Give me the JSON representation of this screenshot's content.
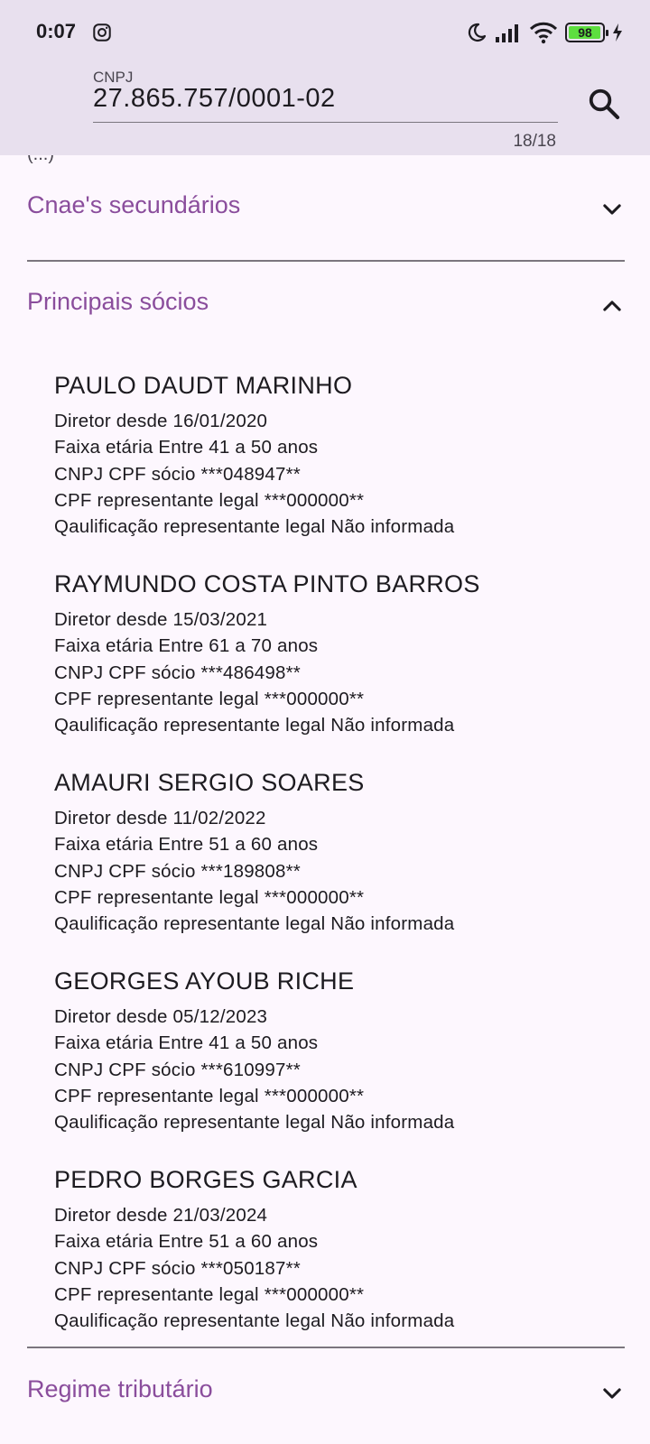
{
  "status_bar": {
    "time": "0:07",
    "battery": "98",
    "icons": [
      "instagram-icon",
      "moon-icon",
      "signal-icon",
      "wifi-icon",
      "battery-icon",
      "charging-icon"
    ]
  },
  "search": {
    "label": "CNPJ",
    "value": "27.865.757/0001-02",
    "counter": "18/18",
    "icon": "search-icon"
  },
  "above_text": "(...)",
  "sections": {
    "cnae_secundarios": {
      "title": "Cnae's secundários",
      "expanded": false
    },
    "principais_socios": {
      "title": "Principais sócios",
      "expanded": true
    },
    "regime_tributario": {
      "title": "Regime tributário",
      "expanded": false
    }
  },
  "partners": [
    {
      "name": "PAULO DAUDT MARINHO",
      "since": "Diretor desde 16/01/2020",
      "age_range": "Faixa etária Entre 41 a 50 anos",
      "cpf": "CNPJ CPF sócio ***048947**",
      "rep_cpf": "CPF representante legal ***000000**",
      "rep_qual": "Qaulificação representante legal Não informada"
    },
    {
      "name": "RAYMUNDO COSTA PINTO BARROS",
      "since": "Diretor desde 15/03/2021",
      "age_range": "Faixa etária Entre 61 a 70 anos",
      "cpf": "CNPJ CPF sócio ***486498**",
      "rep_cpf": "CPF representante legal ***000000**",
      "rep_qual": "Qaulificação representante legal Não informada"
    },
    {
      "name": "AMAURI SERGIO SOARES",
      "since": "Diretor desde 11/02/2022",
      "age_range": "Faixa etária Entre 51 a 60 anos",
      "cpf": "CNPJ CPF sócio ***189808**",
      "rep_cpf": "CPF representante legal ***000000**",
      "rep_qual": "Qaulificação representante legal Não informada"
    },
    {
      "name": "GEORGES AYOUB RICHE",
      "since": "Diretor desde 05/12/2023",
      "age_range": "Faixa etária Entre 41 a 50 anos",
      "cpf": "CNPJ CPF sócio ***610997**",
      "rep_cpf": "CPF representante legal ***000000**",
      "rep_qual": "Qaulificação representante legal Não informada"
    },
    {
      "name": "PEDRO BORGES GARCIA",
      "since": "Diretor desde 21/03/2024",
      "age_range": "Faixa etária Entre 51 a 60 anos",
      "cpf": "CNPJ CPF sócio ***050187**",
      "rep_cpf": "CPF representante legal ***000000**",
      "rep_qual": "Qaulificação representante legal Não informada"
    }
  ],
  "colors": {
    "accent": "#8a4d9c",
    "header_bg": "#e8e0ee",
    "page_bg": "#fdf7fe",
    "battery_green": "#5dde3f"
  }
}
